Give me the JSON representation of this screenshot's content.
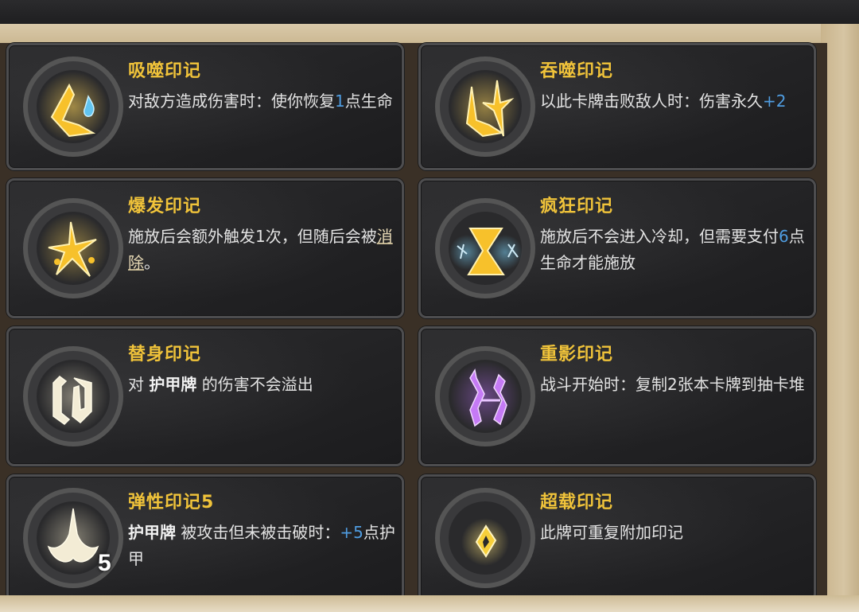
{
  "colors": {
    "title": "#f0c33a",
    "number": "#4f9ce0",
    "desc": "#e3e3e3",
    "card_bg": "#232325",
    "card_border": "#4d4d4f"
  },
  "cards": [
    {
      "title": "吸噬印记",
      "icon": "absorb-rune-icon",
      "desc": [
        {
          "t": "对敌方造成伤害时：使你恢复"
        },
        {
          "t": "1",
          "s": "num"
        },
        {
          "t": "点生命"
        }
      ]
    },
    {
      "title": "吞噬印记",
      "icon": "devour-rune-icon",
      "desc": [
        {
          "t": "以此卡牌击败敌人时：伤害永久"
        },
        {
          "t": "+2",
          "s": "num"
        }
      ]
    },
    {
      "title": "爆发印记",
      "icon": "burst-rune-icon",
      "desc": [
        {
          "t": "施放后会额外触发1次，但随后会被"
        },
        {
          "t": "消除",
          "s": "ul"
        },
        {
          "t": "。"
        }
      ]
    },
    {
      "title": "疯狂印记",
      "icon": "frenzy-rune-icon",
      "desc": [
        {
          "t": "施放后不会进入冷却，但需要支付"
        },
        {
          "t": "6",
          "s": "num"
        },
        {
          "t": "点生命才能施放"
        }
      ]
    },
    {
      "title": "替身印记",
      "icon": "substitute-rune-icon",
      "desc": [
        {
          "t": "对 "
        },
        {
          "t": "护甲牌",
          "s": "kw"
        },
        {
          "t": " 的伤害不会溢出"
        }
      ]
    },
    {
      "title": "重影印记",
      "icon": "ghost-rune-icon",
      "desc": [
        {
          "t": "战斗开始时：复制2张本卡牌到抽卡堆"
        }
      ]
    },
    {
      "title": "弹性印记5",
      "icon": "elastic-rune-icon",
      "level": "5",
      "desc": [
        {
          "t": " "
        },
        {
          "t": "护甲牌",
          "s": "kw"
        },
        {
          "t": " 被攻击但未被击破时："
        },
        {
          "t": "+5",
          "s": "num"
        },
        {
          "t": "点护甲"
        }
      ]
    },
    {
      "title": "超载印记",
      "icon": "overload-rune-icon",
      "desc": [
        {
          "t": "此牌可重复附加印记"
        }
      ]
    }
  ]
}
